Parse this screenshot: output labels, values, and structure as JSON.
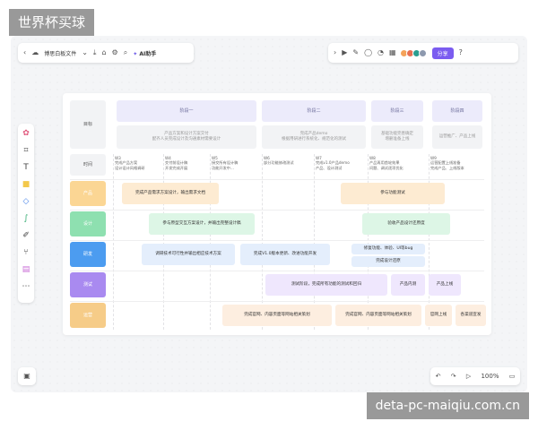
{
  "watermarks": {
    "top": "世界杯买球",
    "bottom": "deta-pc-maiqiu.com.cn"
  },
  "toolbar": {
    "doc_name": "博思白板文件",
    "ai_label": "AI助手",
    "share_label": "分享",
    "icons_left": [
      "back-icon",
      "cloud-icon",
      "chevron-down-icon",
      "download-icon",
      "tag-icon",
      "settings-icon",
      "search-icon"
    ],
    "icons_right": [
      "play-icon",
      "pen-icon",
      "comment-icon",
      "bell-icon",
      "grid-icon"
    ],
    "avatars": [
      "#f4a259",
      "#e76f51",
      "#2a9d8f",
      "#8d99ae"
    ]
  },
  "sidebar_tools": [
    "template-icon",
    "frame-icon",
    "text-icon",
    "sticky-note-icon",
    "shape-icon",
    "connector-icon",
    "pen-tool-icon",
    "mindmap-icon",
    "table-icon",
    "more-icon"
  ],
  "zoom": {
    "level": "100%"
  },
  "colors": {
    "product": "#fbd694",
    "design": "#8ee0b0",
    "dev": "#4c9cf0",
    "test": "#a98af0",
    "ops": "#f6cc88",
    "task_orange": "#fdebd2",
    "task_green": "#ddf6e6",
    "task_blue": "#e4eefc",
    "task_purple": "#efe7fd",
    "task_peach": "#fdeee0"
  },
  "grid": {
    "goal_label": "目标",
    "time_label": "时间",
    "phases": [
      {
        "title": "阶段一",
        "desc": "产品方案和设计方案交付\n配齐人员完成设计及沟通素材需要设计"
      },
      {
        "title": "阶段二",
        "desc": "完成产品demo\n根据用研进行系统化、规范化的测试"
      },
      {
        "title": "阶段三",
        "desc": "基础功能完善确定\n增删准备上线"
      },
      {
        "title": "阶段四",
        "desc": "运营推广、产品上线"
      }
    ],
    "weeks": [
      {
        "w": "W3",
        "t": "完成产品方案\n设计设计风格调研"
      },
      {
        "w": "W4",
        "t": "交付前设计稿\n开发完成开展"
      },
      {
        "w": "W5",
        "t": "接交所有设计稿\n功能开发中..."
      },
      {
        "w": "W6",
        "t": "部分功能修改测试"
      },
      {
        "w": "W7",
        "t": "完成v1.0产品demo\n产品、设计测试"
      },
      {
        "w": "W8",
        "t": "产品再用首轮效果\n问题、调试逐项优化"
      },
      {
        "w": "W9",
        "t": "运营配置上线准备\n完成产品、上线版本"
      }
    ],
    "rows": [
      {
        "label": "产品",
        "tasks": [
          "完成产品需求方案设计，输出需求文档",
          "参与功能测试"
        ]
      },
      {
        "label": "设计",
        "tasks": [
          "参与原型交互方案设计，并输出完整设计稿",
          "验收产品设计还原度"
        ]
      },
      {
        "label": "研发",
        "tasks": [
          "调研技术可行性并输出相应技术方案",
          "完成V1.0版本更新、改进功能开发",
          "修复功能、体验、UI等bug",
          "完成设计还原"
        ]
      },
      {
        "label": "测试",
        "tasks": [
          "测试阶段，完成所有功能的测试和回归",
          "产品内测",
          "产品上线"
        ]
      },
      {
        "label": "运营",
        "tasks": [
          "完成官网、内容页面等网站相关策划",
          "完成官网、内容页面等网站相关策划",
          "官网上线",
          "各渠道宣发"
        ]
      }
    ]
  }
}
